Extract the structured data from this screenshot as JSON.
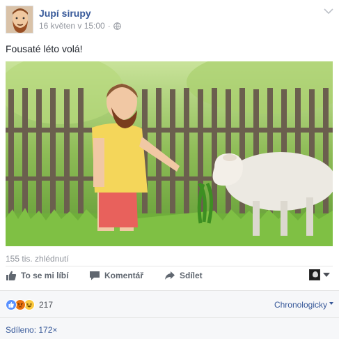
{
  "post": {
    "page_name": "Jupí sirupy",
    "timestamp": "16 květen v 15:00",
    "separator": "·",
    "caption": "Fousaté léto volá!",
    "views": "155 tis. zhlédnutí"
  },
  "actions": {
    "like_label": "To se mi líbí",
    "comment_label": "Komentář",
    "share_label": "Sdílet"
  },
  "reactions": {
    "icons": [
      "like-icon",
      "angry-icon",
      "haha-icon"
    ],
    "count": "217"
  },
  "ordering": {
    "selected": "Chronologicky"
  },
  "shares": {
    "label": "Sdíleno: 172×"
  },
  "colors": {
    "link_blue": "#365899",
    "meta_gray": "#90949c",
    "action_gray": "#606770",
    "like_blue": "#5890ff",
    "reaction_yellow": "#fcc93e",
    "angry_red": "#e9710f"
  }
}
